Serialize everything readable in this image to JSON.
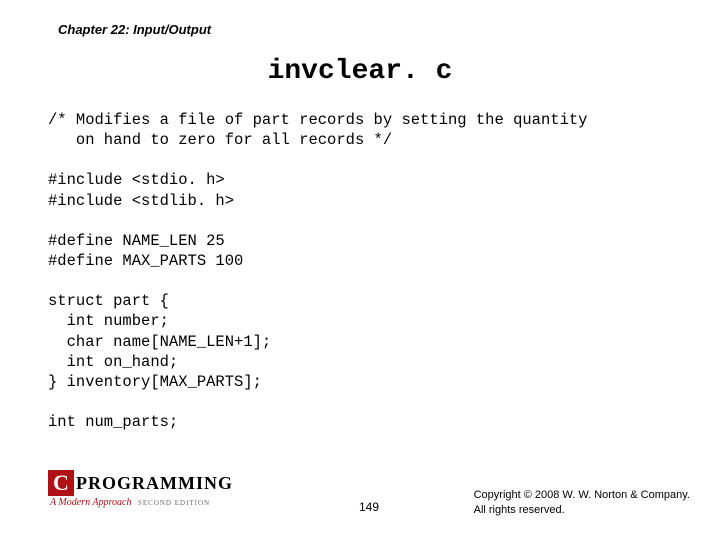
{
  "header": {
    "chapter": "Chapter 22: Input/Output"
  },
  "title": "invclear. c",
  "code": "/* Modifies a file of part records by setting the quantity\n   on hand to zero for all records */\n\n#include <stdio. h>\n#include <stdlib. h>\n\n#define NAME_LEN 25\n#define MAX_PARTS 100\n\nstruct part {\n  int number;\n  char name[NAME_LEN+1];\n  int on_hand;\n} inventory[MAX_PARTS];\n\nint num_parts;",
  "footer": {
    "logo_letter": "C",
    "logo_word": "PROGRAMMING",
    "logo_sub": "A Modern Approach",
    "logo_edition": "SECOND EDITION",
    "page": "149",
    "copyright_line1": "Copyright © 2008 W. W. Norton & Company.",
    "copyright_line2": "All rights reserved."
  }
}
